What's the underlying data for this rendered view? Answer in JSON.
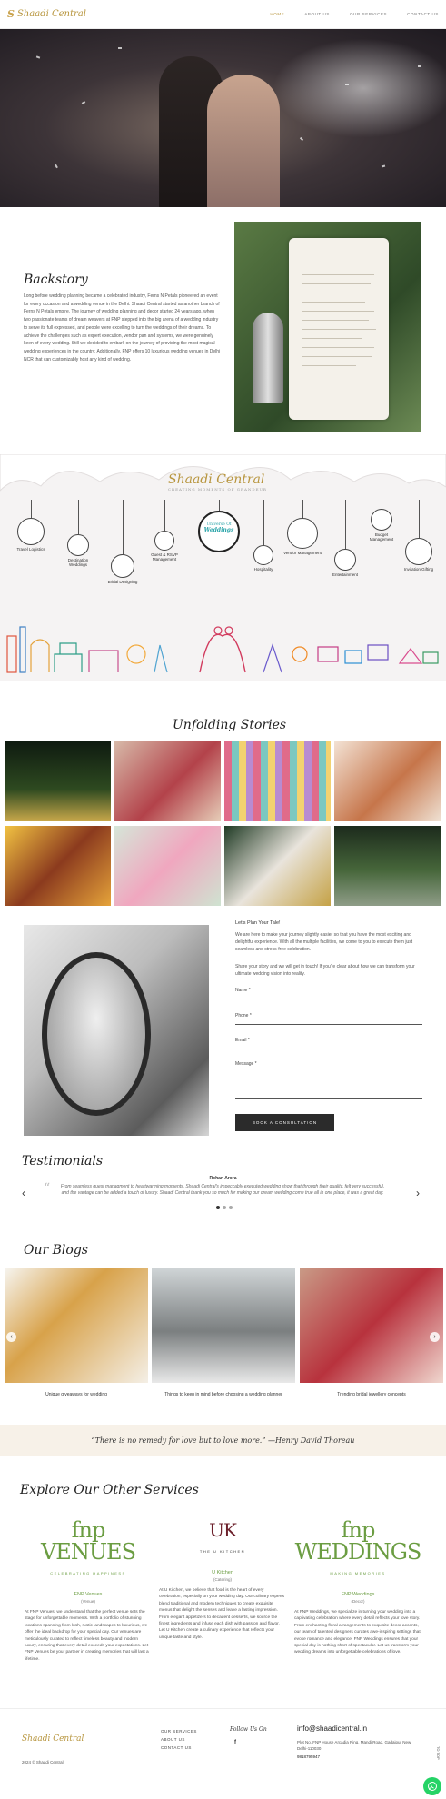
{
  "header": {
    "logo_text": "Shaadi Central",
    "nav": [
      "HOME",
      "ABOUT US",
      "OUR SERVICES",
      "CONTACT US"
    ]
  },
  "backstory": {
    "title": "Backstory",
    "text": "Long before wedding planning became a celebrated industry, Ferns N Petals pioneered an event for every occasion and a wedding venue in the Delhi. Shaadi Central started as another branch of Ferns N Petals empire. The journey of wedding planning and decor started 24 years ago, when two passionate teams of dream weavers at FNP stepped into the big arena of a wedding industry to serve its full expressed, and people were excelling to turn the weddings of their dreams. To achieve the challenges such as expert execution, vendor pan and systems, we were genuinely keen of every wedding. Still we decided to embark on the journey of providing the most magical wedding experiences in the country. Additionally, FNP offers 10 luxurious wedding venues in Delhi NCR that can customizably host any kind of wedding."
  },
  "services_illustration": {
    "logo_text": "Shaadi Central",
    "logo_tagline": "CREATING MOMENTS OF GRANDEUR",
    "center_label_top": "Universe Of",
    "center_label_bottom": "Weddings",
    "items": [
      "Travel Logistics",
      "Destination Weddings",
      "Bridal Designing",
      "Guest & RSVP Management",
      "Hospitality",
      "Vendor Management",
      "Entertainment",
      "Budget Management",
      "Invitation Gifting"
    ]
  },
  "stories": {
    "title": "Unfolding Stories"
  },
  "contact": {
    "heading": "Let's Plan Your Tale!",
    "para1": "We are here to make your journey slightly easier so that you have the most exciting and delightful experience. With all the multiple facilities, we come to you to execute them just seamless and stress-free celebration.",
    "para2": "Share your story and we will get in touch! If you're clear about how we can transform your ultimate wedding vision into reality.",
    "fields": [
      "Name *",
      "Phone *",
      "Email *",
      "Message *"
    ],
    "button": "BOOK A CONSULTATION"
  },
  "testimonials": {
    "title": "Testimonials",
    "name": "Rohan Arora",
    "quote": "From seamless guest managment to heartwarming moments, Shaadi Central's impeccably executed wedding show that through their quality, felt very successful, and the vantage can be added a touch of luxury. Shaadi Central thank you so much for making our dream wedding come true all in one place, it was a great day.",
    "prev": "‹",
    "next": "›"
  },
  "blogs": {
    "title": "Our Blogs",
    "items": [
      {
        "caption": "Unique giveaways for wedding"
      },
      {
        "caption": "Things to keep in mind before choosing a wedding planner"
      },
      {
        "caption": "Trending bridal jewellery concepts"
      }
    ]
  },
  "quote_banner": {
    "text": "“There is no remedy for love but to love more.” —Henry David Thoreau"
  },
  "other_services": {
    "title": "Explore Our Other Services",
    "items": [
      {
        "brand": "fnp VENUES",
        "tagline": "CELEBRATING HAPPINESS",
        "name": "FNP Venues",
        "sub": "(Venue)",
        "desc": "At FNP Venues, we understand that the perfect venue sets the stage for unforgettable moments. With a portfolio of stunning locations spanning from lush, rustic landscapes to luxurious, we offer the ideal backdrop for your special day. Our venues are meticulously curated to reflect timeless beauty and modern luxury, ensuring that every detail exceeds your expectations. Let FNP Venues be your partner in creating memories that will last a lifetime."
      },
      {
        "brand": "UK",
        "tagline": "THE U KITCHEN",
        "name": "U Kitchen",
        "sub": "(Catering)",
        "desc": "At U Kitchen, we believe that food is the heart of every celebration, especially on your wedding day. Our culinary experts blend traditional and modern techniques to create exquisite menus that delight the senses and leave a lasting impression. From elegant appetizers to decadent desserts, we source the finest ingredients and infuse each dish with passion and flavor. Let U Kitchen create a culinary experience that reflects your unique taste and style."
      },
      {
        "brand": "fnp WEDDINGS",
        "tagline": "MAKING MEMORIES",
        "name": "FNP Weddings",
        "sub": "(Decor)",
        "desc": "At FNP Weddings, we specialize in turning your wedding into a captivating celebration where every detail reflects your love story. From enchanting floral arrangements to exquisite decor accents, our team of talented designers curates awe-inspiring settings that evoke romance and elegance. FNP Weddings ensures that your special day is nothing short of spectacular. Let us transform your wedding dreams into unforgettable celebrations of love."
      }
    ]
  },
  "footer": {
    "logo_text": "Shaadi Central",
    "copyright": "2024 © Shaadi Central",
    "links": [
      "OUR SERVICES",
      "ABOUT US",
      "CONTACT US"
    ],
    "follow": "Follow Us On",
    "fb": "f",
    "email": "info@shaadicentral.in",
    "address": "Plot No. FNP House Arcadia Ring, Mandi Road, Gadaipur New Delhi-110030",
    "phone": "9818795947",
    "top_label": "TO TOP"
  }
}
